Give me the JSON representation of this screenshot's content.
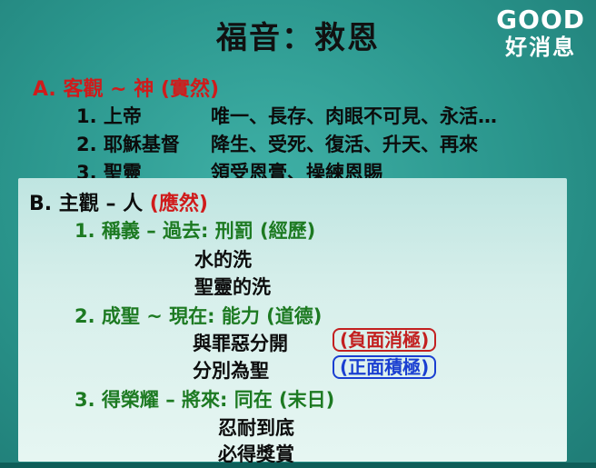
{
  "title": "福音：救恩",
  "logo": {
    "top": "GOOD",
    "bottom": "好消息"
  },
  "section_a": {
    "label": "A. 客觀 ~ 神",
    "tag": "(實然)",
    "items": [
      {
        "num": "1. 上帝",
        "text": "唯一、長存、肉眼不可見、永活…"
      },
      {
        "num": "2. 耶穌基督",
        "text": "降生、受死、復活、升天、再來"
      },
      {
        "num": "3. 聖靈",
        "text": "領受恩膏、操練恩賜"
      }
    ]
  },
  "section_b": {
    "label": "B. 主觀 – 人",
    "tag": "(應然)",
    "items": [
      {
        "head": "1. 稱義 – 過去: 刑罰 (經歷)",
        "subs": [
          "水的洗",
          "聖靈的洗"
        ]
      },
      {
        "head": "2. 成聖 ~ 現在: 能力 (道德)",
        "subs": [
          "與罪惡分開",
          "分別為聖"
        ],
        "tags": [
          "(負面消極)",
          "(正面積極)"
        ]
      },
      {
        "head": "3. 得榮耀 – 將來: 同在 (末日)",
        "subs": [
          "忍耐到底",
          "必得獎賞"
        ]
      }
    ]
  }
}
